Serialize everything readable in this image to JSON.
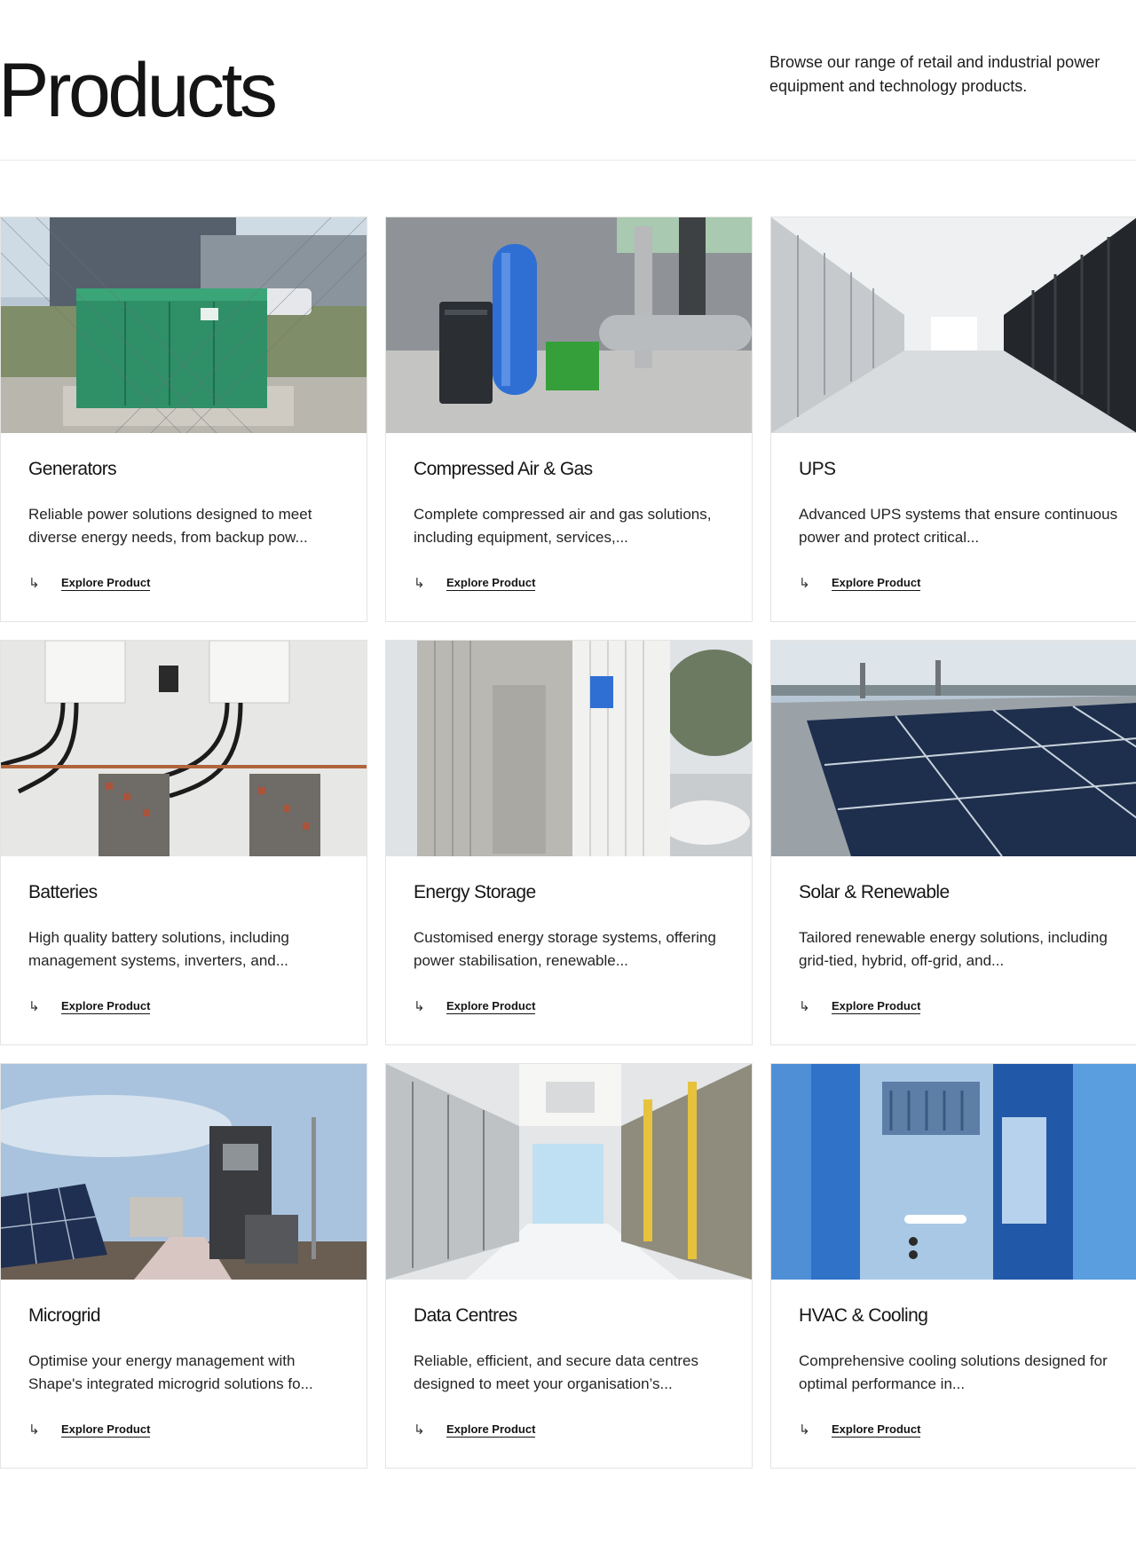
{
  "header": {
    "title": "Products",
    "intro": "Browse our range of retail and industrial power equipment and technology products."
  },
  "products": [
    {
      "title": "Generators",
      "description": "Reliable power solutions designed to meet diverse energy needs, from backup pow...",
      "link": "Explore Product",
      "image": "generator-photo"
    },
    {
      "title": "Compressed Air & Gas",
      "description": "Complete compressed air and gas solutions, including equipment, services,...",
      "link": "Explore Product",
      "image": "compressor-photo"
    },
    {
      "title": "UPS",
      "description": "Advanced UPS systems that ensure continuous power and protect critical...",
      "link": "Explore Product",
      "image": "ups-aisle-photo"
    },
    {
      "title": "Batteries",
      "description": "High quality battery solutions, including management systems, inverters, and...",
      "link": "Explore Product",
      "image": "battery-bank-photo"
    },
    {
      "title": "Energy Storage",
      "description": "Customised energy storage systems, offering power stabilisation, renewable...",
      "link": "Explore Product",
      "image": "storage-container-photo"
    },
    {
      "title": "Solar & Renewable",
      "description": "Tailored renewable energy solutions, including grid-tied, hybrid, off-grid, and...",
      "link": "Explore Product",
      "image": "solar-panels-photo"
    },
    {
      "title": "Microgrid",
      "description": "Optimise your energy management with Shape's integrated microgrid solutions fo...",
      "link": "Explore Product",
      "image": "microgrid-photo"
    },
    {
      "title": "Data Centres",
      "description": "Reliable, efficient, and secure data centres designed to meet your organisation’s...",
      "link": "Explore Product",
      "image": "data-centre-photo"
    },
    {
      "title": "HVAC & Cooling",
      "description": "Comprehensive cooling solutions designed for optimal performance in...",
      "link": "Explore Product",
      "image": "hvac-unit-photo"
    }
  ],
  "icons": {
    "link_arrow": "↳"
  },
  "colors": {
    "text": "#151515",
    "border": "#e4e4e4",
    "generator_green": "#2f8f67",
    "compressor_blue": "#2f6fd4",
    "hvac_blue": "#3f8fd8"
  }
}
